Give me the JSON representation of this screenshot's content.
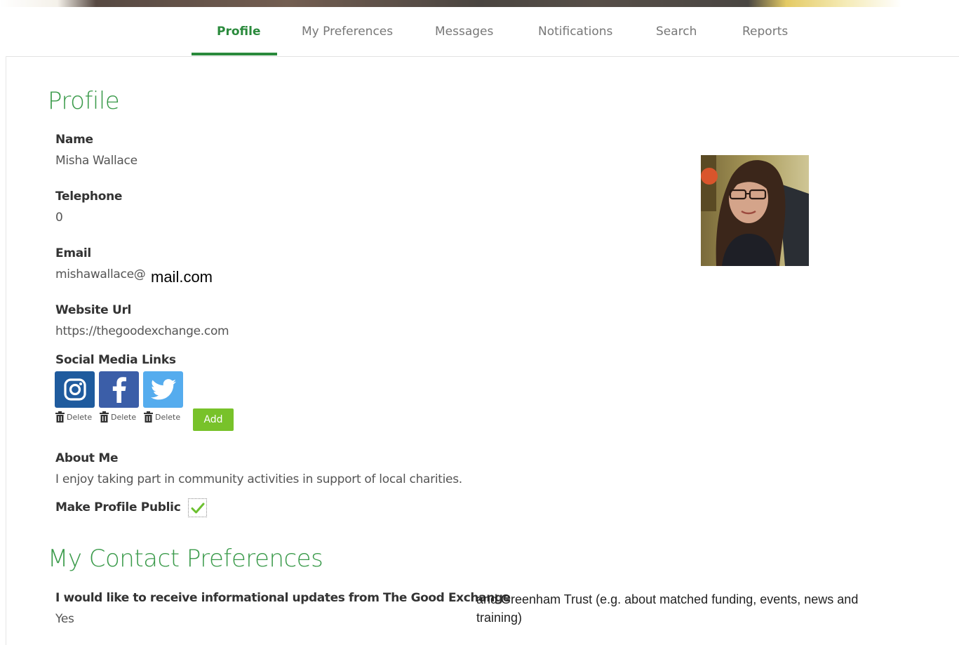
{
  "nav": {
    "tabs": [
      {
        "label": "Profile",
        "active": true
      },
      {
        "label": "My Preferences"
      },
      {
        "label": "Messages"
      },
      {
        "label": "Notifications"
      },
      {
        "label": "Search"
      },
      {
        "label": "Reports"
      }
    ]
  },
  "profile": {
    "heading": "Profile",
    "name_label": "Name",
    "name_value": "Misha Wallace",
    "telephone_label": "Telephone",
    "telephone_value": "0",
    "email_label": "Email",
    "email_value_part1": "mishawallace@",
    "email_value_part2": "mail.com",
    "website_label": "Website Url",
    "website_value": "https://thegoodexchange.com",
    "social_label": "Social Media Links",
    "social_links": [
      {
        "icon": "instagram-icon",
        "color": "#1f5b9e",
        "delete_label": "Delete"
      },
      {
        "icon": "facebook-icon",
        "color": "#3b5ea8",
        "delete_label": "Delete"
      },
      {
        "icon": "twitter-icon",
        "color": "#55acee",
        "delete_label": "Delete"
      }
    ],
    "add_label": "Add",
    "about_label": "About Me",
    "about_value": "I enjoy taking part in community activities in support of local charities.",
    "public_label": "Make Profile Public",
    "public_checked": true
  },
  "contact": {
    "heading": "My Contact Preferences",
    "question_part1": "I would like to receive informational updates from The Good Exchange",
    "question_part2": "and Greenham Trust (e.g. about matched funding, events, news and training)",
    "answer": "Yes"
  },
  "colors": {
    "accent": "#2a8a3c",
    "heading": "#3a9a4a",
    "add_button": "#78c22a"
  }
}
